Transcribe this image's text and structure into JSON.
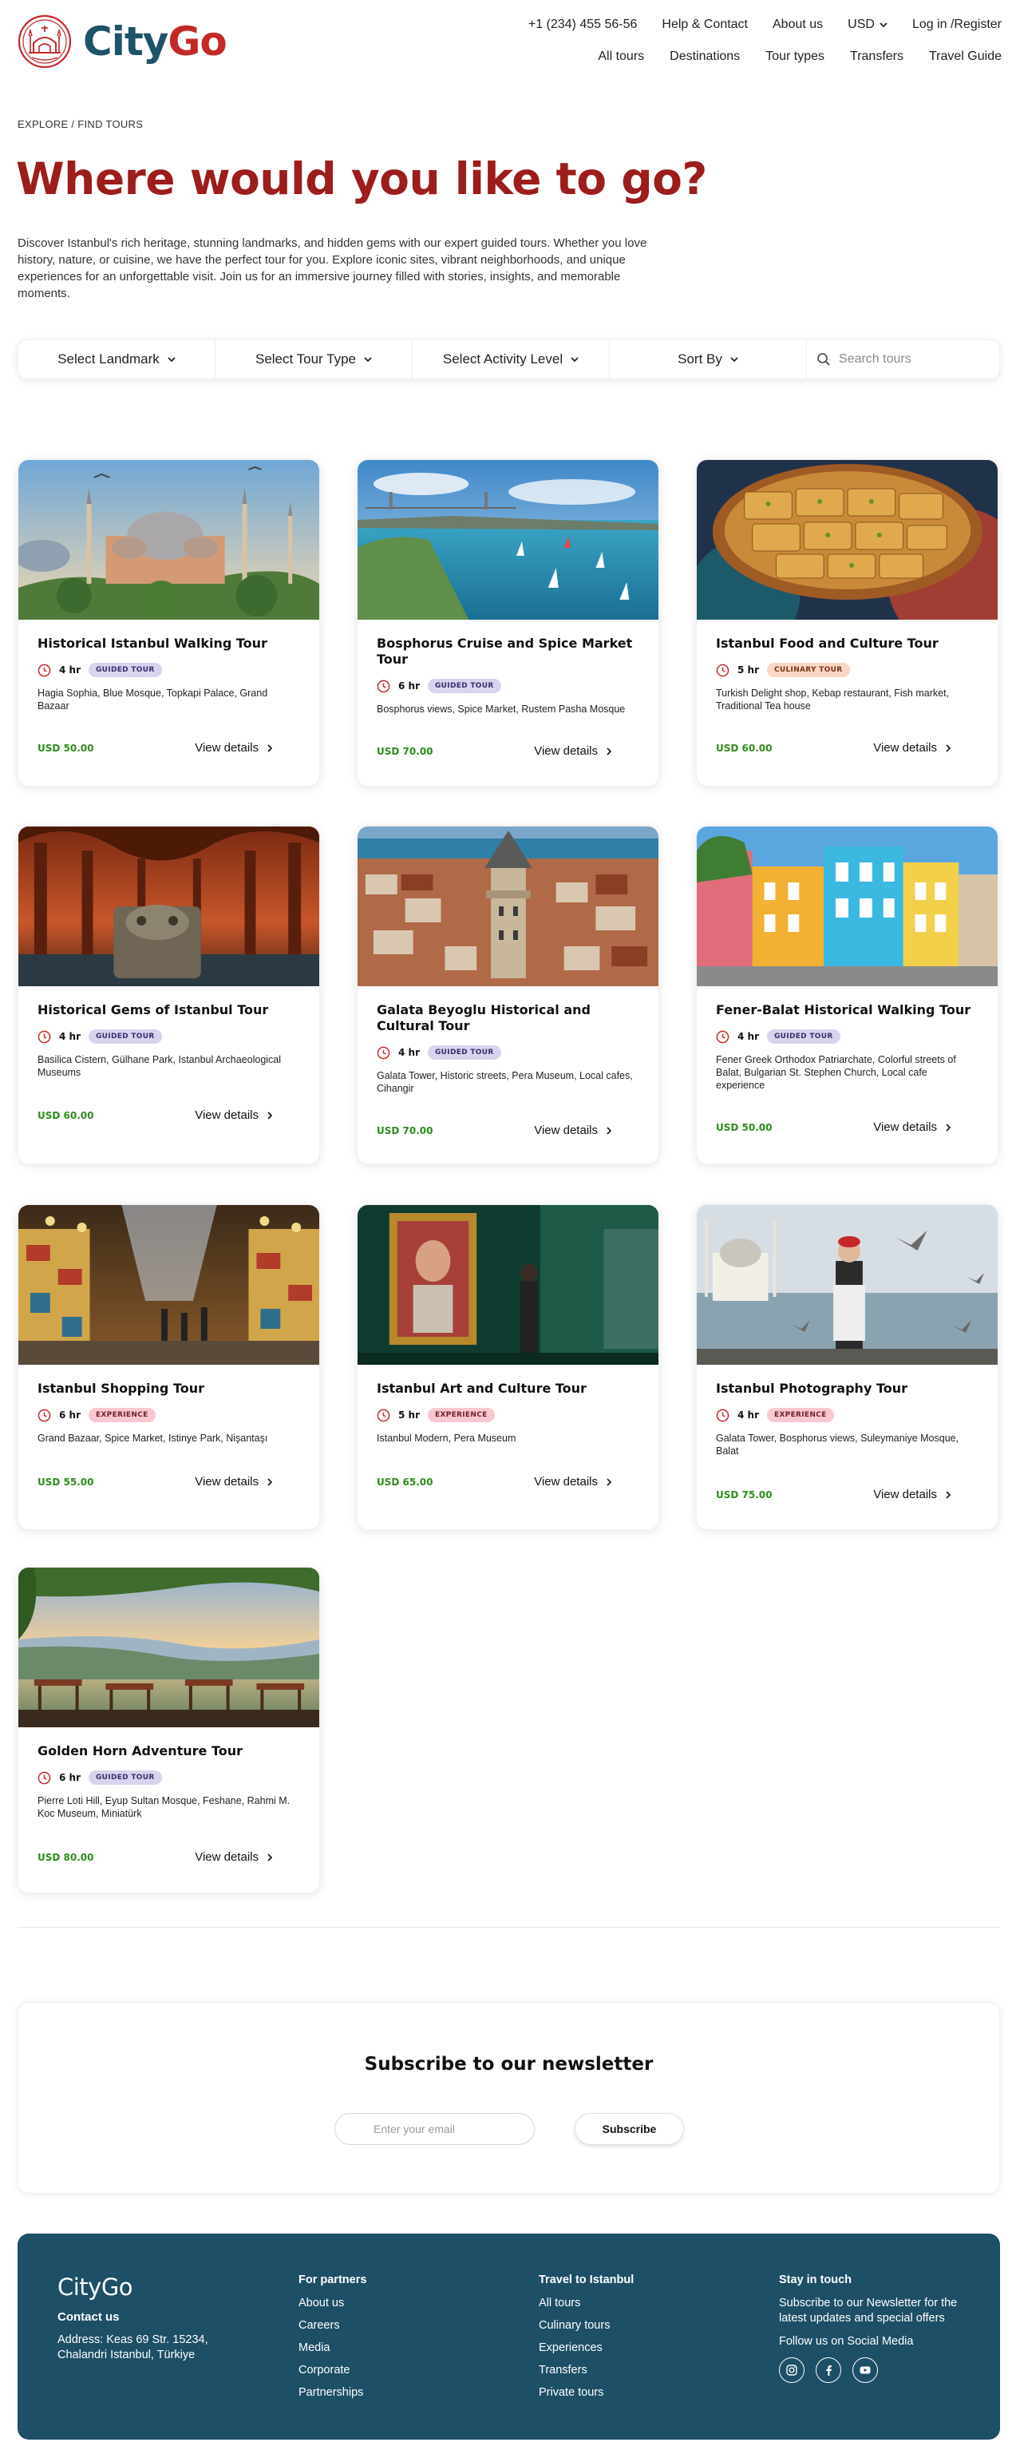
{
  "brand": {
    "name_prefix": "City",
    "name_suffix": "Go",
    "primary_color": "#1e5369",
    "accent_color": "#c62828"
  },
  "top_links": {
    "phone": "+1 (234) 455 56-56",
    "help": "Help & Contact",
    "about": "About us",
    "currency": "USD",
    "login": "Log in /Register"
  },
  "main_nav": {
    "all_tours": "All tours",
    "destinations": "Destinations",
    "tour_types": "Tour types",
    "transfers": "Transfers",
    "travel_guide": "Travel Guide"
  },
  "breadcrumb": "EXPLORE / FIND TOURS",
  "hero": {
    "title": "Where would you like to go?",
    "description": "Discover Istanbul's rich heritage, stunning landmarks, and hidden gems with our expert guided tours. Whether you love history, nature, or cuisine, we have the perfect tour for you. Explore iconic sites, vibrant neighborhoods, and unique experiences for an unforgettable visit. Join us for an immersive journey filled with stories, insights, and memorable moments."
  },
  "filters": {
    "landmark": "Select Landmark",
    "tour_type": "Select Tour Type",
    "activity": "Select Activity Level",
    "sort": "Sort By",
    "search_placeholder": "Search tours"
  },
  "card_link_label": "View details",
  "tours": [
    {
      "title": "Historical Istanbul Walking Tour",
      "duration": "4 hr",
      "badge": "GUIDED TOUR",
      "places": "Hagia Sophia, Blue Mosque, Topkapi Palace, Grand Bazaar",
      "price": "USD 50.00"
    },
    {
      "title": "Bosphorus Cruise and Spice Market Tour",
      "duration": "6 hr",
      "badge": "GUIDED TOUR",
      "places": "Bosphorus views, Spice Market, Rustem Pasha Mosque",
      "price": "USD 70.00"
    },
    {
      "title": "Istanbul Food and Culture Tour",
      "duration": "5 hr",
      "badge": "CULINARY TOUR",
      "places": "Turkish Delight shop, Kebap restaurant, Fish market, Traditional Tea house",
      "price": "USD 60.00"
    },
    {
      "title": "Historical Gems of Istanbul Tour",
      "duration": "4 hr",
      "badge": "GUIDED TOUR",
      "places": "Basilica Cistern, Gülhane Park, Istanbul Archaeological Museums",
      "price": "USD 60.00"
    },
    {
      "title": "Galata Beyoglu Historical and Cultural Tour",
      "duration": "4 hr",
      "badge": "GUIDED TOUR",
      "places": "Galata Tower, Historic streets, Pera Museum, Local cafes, Cihangir",
      "price": "USD 70.00"
    },
    {
      "title": "Fener-Balat Historical Walking Tour",
      "duration": "4 hr",
      "badge": "GUIDED TOUR",
      "places": "Fener Greek Orthodox Patriarchate, Colorful streets of Balat, Bulgarian St. Stephen Church, Local cafe experience",
      "price": "USD 50.00"
    },
    {
      "title": "Istanbul Shopping Tour",
      "duration": "6 hr",
      "badge": "EXPERIENCE",
      "places": "Grand Bazaar, Spice Market, Istinye Park, Nişantaşı",
      "price": "USD 55.00"
    },
    {
      "title": "Istanbul Art and Culture Tour",
      "duration": "5 hr",
      "badge": "EXPERIENCE",
      "places": "Istanbul Modern, Pera Museum",
      "price": "USD 65.00"
    },
    {
      "title": "Istanbul Photography Tour",
      "duration": "4 hr",
      "badge": "EXPERIENCE",
      "places": "Galata Tower, Bosphorus views, Suleymaniye Mosque, Balat",
      "price": "USD 75.00"
    },
    {
      "title": "Golden Horn Adventure Tour",
      "duration": "6 hr",
      "badge": "GUIDED TOUR",
      "places": "Pierre Loti Hill, Eyup Sultan Mosque, Feshane, Rahmi M. Koc Museum, Miniatürk",
      "price": "USD 80.00"
    }
  ],
  "newsletter": {
    "title": "Subscribe to our newsletter",
    "placeholder": "Enter your email",
    "button": "Subscribe"
  },
  "footer": {
    "logo": "CityGo",
    "contact_heading": "Contact us",
    "address": "Address: Keas 69 Str. 15234, Chalandri Istanbul, Türkiye",
    "partners": {
      "heading": "For partners",
      "links": [
        "About us",
        "Careers",
        "Media",
        "Corporate",
        "Partnerships"
      ]
    },
    "travel": {
      "heading": "Travel to Istanbul",
      "links": [
        "All tours",
        "Culinary tours",
        "Experiences",
        "Transfers",
        "Private tours"
      ]
    },
    "stay": {
      "heading": "Stay in touch",
      "text": "Subscribe to our Newsletter for the latest updates and special offers",
      "follow": "Follow us on Social Media",
      "socials": [
        "instagram-icon",
        "facebook-icon",
        "youtube-icon"
      ]
    },
    "background": "#1d4f66"
  }
}
